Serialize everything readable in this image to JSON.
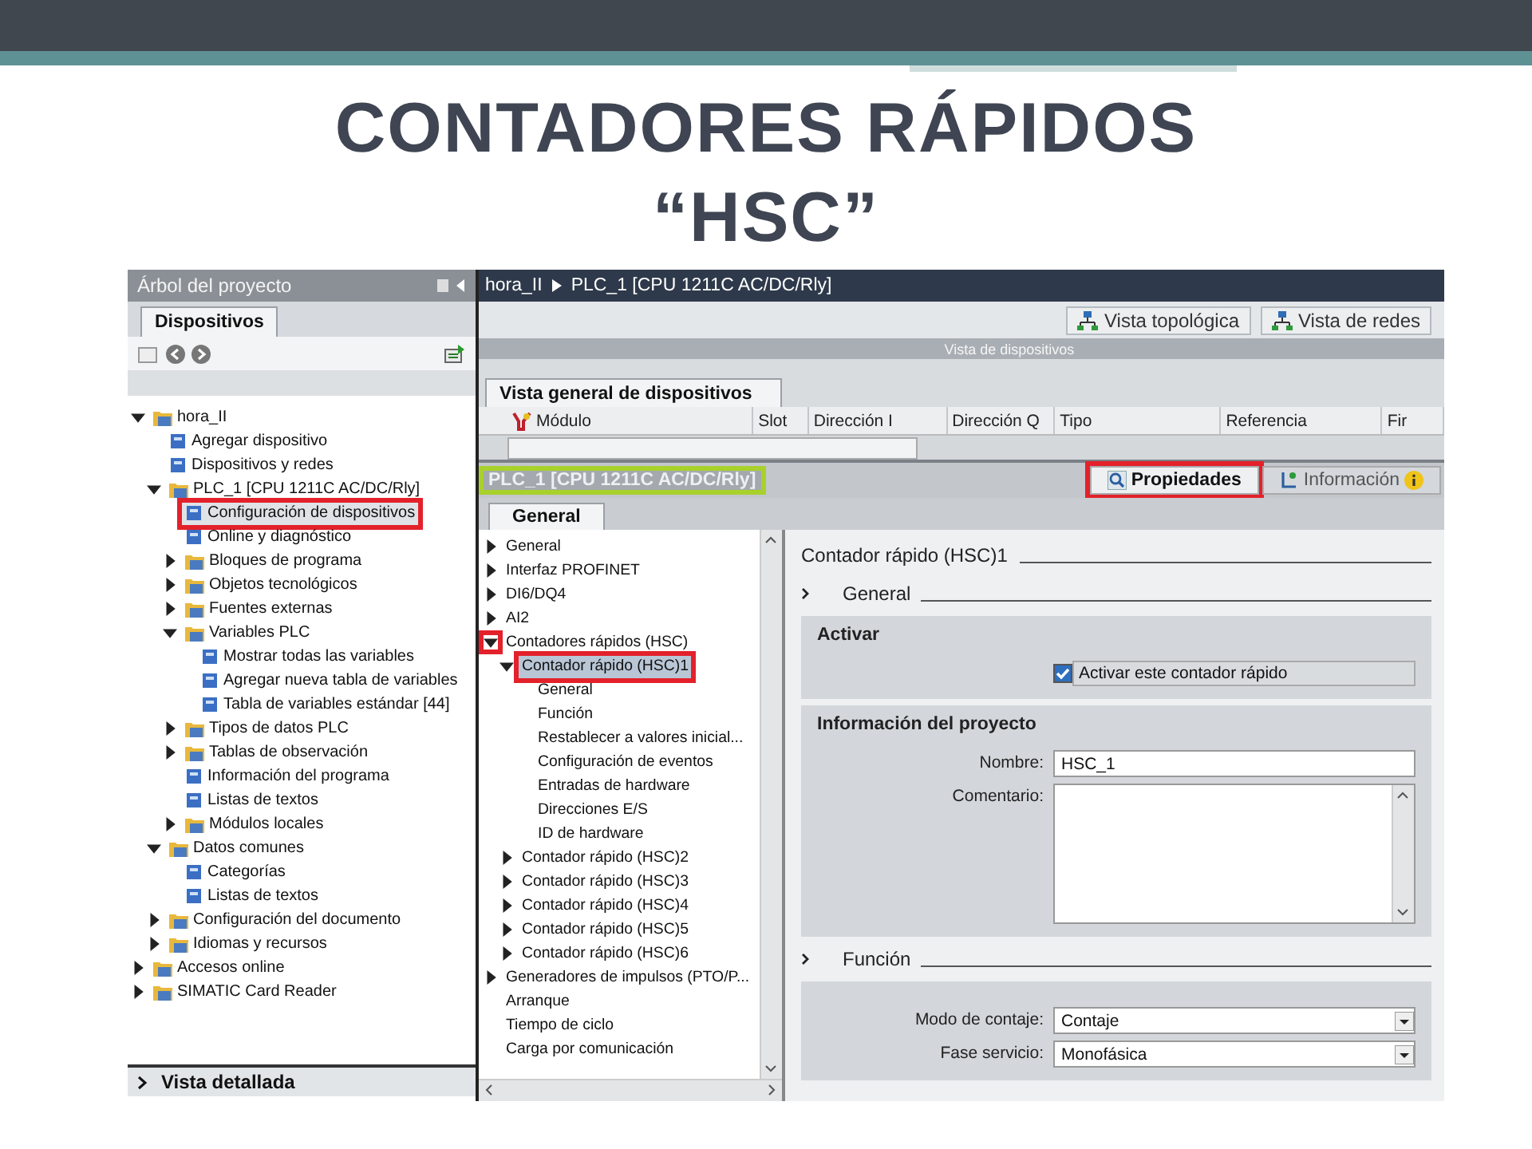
{
  "slide": {
    "title_lines": [
      "CONTADORES RÁPIDOS",
      "“HSC”"
    ]
  },
  "project_tree": {
    "header": "Árbol del proyecto",
    "tab": {
      "label": "Dispositivos",
      "selected": true
    },
    "footer": "Vista detallada",
    "items": [
      {
        "label": "hora_II",
        "expanded": true,
        "selected": false,
        "children": [
          {
            "label": "Agregar dispositivo",
            "selected": false
          },
          {
            "label": "Dispositivos y redes",
            "selected": false
          },
          {
            "label": "PLC_1 [CPU 1211C AC/DC/Rly]",
            "expanded": true,
            "selected": false,
            "children": [
              {
                "label": "Configuración de dispositivos",
                "selected": true,
                "framed": true
              },
              {
                "label": "Online y diagnóstico",
                "selected": false
              },
              {
                "label": "Bloques de programa",
                "expanded": false,
                "selected": false
              },
              {
                "label": "Objetos tecnológicos",
                "expanded": false,
                "selected": false
              },
              {
                "label": "Fuentes externas",
                "expanded": false,
                "selected": false
              },
              {
                "label": "Variables PLC",
                "expanded": true,
                "selected": false,
                "children": [
                  {
                    "label": "Mostrar todas las variables",
                    "selected": false
                  },
                  {
                    "label": "Agregar nueva tabla de variables",
                    "selected": false
                  },
                  {
                    "label": "Tabla de variables estándar [44]",
                    "selected": false
                  }
                ]
              },
              {
                "label": "Tipos de datos PLC",
                "expanded": false,
                "selected": false
              },
              {
                "label": "Tablas de observación",
                "expanded": false,
                "selected": false
              },
              {
                "label": "Información del programa",
                "selected": false
              },
              {
                "label": "Listas de textos",
                "selected": false
              },
              {
                "label": "Módulos locales",
                "expanded": false,
                "selected": false
              }
            ]
          },
          {
            "label": "Datos comunes",
            "expanded": true,
            "selected": false,
            "children": [
              {
                "label": "Categorías",
                "selected": false
              },
              {
                "label": "Listas de textos",
                "selected": false
              }
            ]
          },
          {
            "label": "Configuración del documento",
            "expanded": false,
            "selected": false
          },
          {
            "label": "Idiomas y recursos",
            "expanded": false,
            "selected": false
          }
        ]
      },
      {
        "label": "Accesos online",
        "expanded": false,
        "selected": false
      },
      {
        "label": "SIMATIC Card Reader",
        "expanded": false,
        "selected": false
      }
    ]
  },
  "editor": {
    "breadcrumb": [
      "hora_II",
      "PLC_1 [CPU 1211C AC/DC/Rly]"
    ],
    "view_buttons": [
      "Vista topológica",
      "Vista de redes"
    ],
    "view_bar": "Vista de dispositivos",
    "overview_tab": {
      "label": "Vista general de dispositivos",
      "selected": true
    },
    "columns": [
      "Módulo",
      "Slot",
      "Dirección I",
      "Dirección Q",
      "Tipo",
      "Referencia",
      "Fir"
    ]
  },
  "inspector": {
    "title": "PLC_1 [CPU 1211C AC/DC/Rly]",
    "title_framed": true,
    "tabs": [
      {
        "label": "Propiedades",
        "selected": true,
        "framed": true
      },
      {
        "label": "Información",
        "selected": false,
        "framed": false
      }
    ],
    "subtab": {
      "label": "General",
      "selected": true
    },
    "nav": [
      {
        "label": "General",
        "expanded": false,
        "selected": false
      },
      {
        "label": "Interfaz PROFINET",
        "expanded": false,
        "selected": false
      },
      {
        "label": "DI6/DQ4",
        "expanded": false,
        "selected": false
      },
      {
        "label": "AI2",
        "expanded": false,
        "selected": false
      },
      {
        "label": "Contadores rápidos (HSC)",
        "expanded": true,
        "selected": false,
        "toggle_framed": true,
        "children": [
          {
            "label": "Contador rápido (HSC)1",
            "expanded": true,
            "selected": true,
            "framed": true,
            "children": [
              {
                "label": "General",
                "selected": false
              },
              {
                "label": "Función",
                "selected": false
              },
              {
                "label": "Restablecer a valores inicial...",
                "selected": false
              },
              {
                "label": "Configuración de eventos",
                "selected": false
              },
              {
                "label": "Entradas de hardware",
                "selected": false
              },
              {
                "label": "Direcciones E/S",
                "selected": false
              },
              {
                "label": "ID de hardware",
                "selected": false
              }
            ]
          },
          {
            "label": "Contador rápido (HSC)2",
            "expanded": false,
            "selected": false
          },
          {
            "label": "Contador rápido (HSC)3",
            "expanded": false,
            "selected": false
          },
          {
            "label": "Contador rápido (HSC)4",
            "expanded": false,
            "selected": false
          },
          {
            "label": "Contador rápido (HSC)5",
            "expanded": false,
            "selected": false
          },
          {
            "label": "Contador rápido (HSC)6",
            "expanded": false,
            "selected": false
          }
        ]
      },
      {
        "label": "Generadores de impulsos (PTO/P...",
        "expanded": false,
        "selected": false
      },
      {
        "label": "Arranque",
        "selected": false
      },
      {
        "label": "Tiempo de ciclo",
        "selected": false
      },
      {
        "label": "Carga por comunicación",
        "selected": false
      }
    ],
    "content": {
      "heading": "Contador rápido (HSC)1",
      "sections": [
        {
          "title": "General",
          "groups": [
            {
              "title": "Activar",
              "fields": [
                {
                  "kind": "checkbox",
                  "label": "Activar este contador rápido",
                  "checked": true
                }
              ]
            },
            {
              "title": "Información del proyecto",
              "fields": [
                {
                  "kind": "text",
                  "label": "Nombre:",
                  "value": "HSC_1"
                },
                {
                  "kind": "textarea",
                  "label": "Comentario:"
                }
              ]
            }
          ]
        },
        {
          "title": "Función",
          "groups": [
            {
              "fields": [
                {
                  "kind": "dropdown",
                  "label": "Modo de contaje:",
                  "value": "Contaje"
                },
                {
                  "kind": "dropdown",
                  "label": "Fase servicio:",
                  "value": "Monofásica"
                }
              ]
            }
          ]
        }
      ]
    }
  }
}
